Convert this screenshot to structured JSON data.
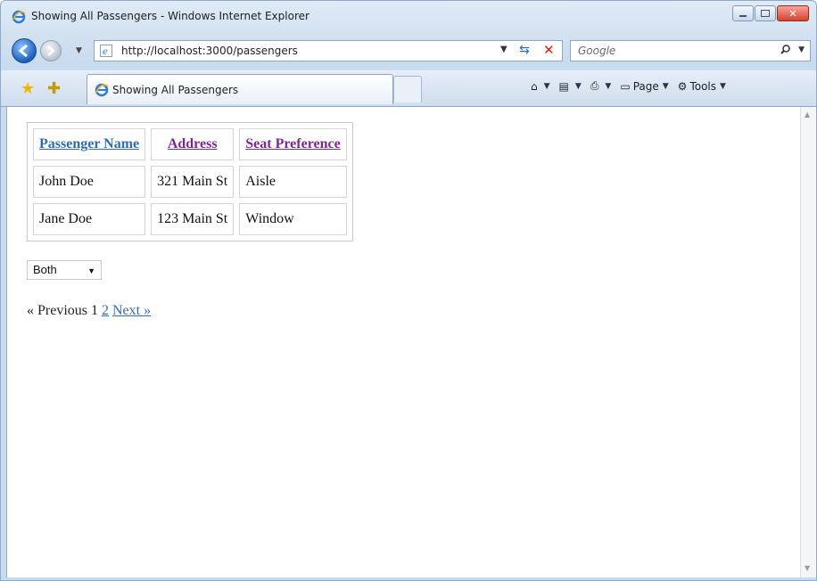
{
  "window": {
    "title": "Showing All Passengers - Windows Internet Explorer"
  },
  "navbar": {
    "url": "http://localhost:3000/passengers",
    "search_placeholder": "Google"
  },
  "tabbar": {
    "tab_title": "Showing All Passengers",
    "commands": [
      {
        "label": "",
        "icon": "home-icon"
      },
      {
        "label": "",
        "icon": "rss-feed-icon"
      },
      {
        "label": "",
        "icon": "print-icon"
      },
      {
        "label": "Page",
        "icon": "page-icon"
      },
      {
        "label": "Tools",
        "icon": "gear-icon"
      }
    ]
  },
  "table": {
    "headers": [
      "Passenger Name",
      "Address",
      "Seat Preference"
    ],
    "header_colors": [
      "#2f6cb0",
      "#7b2a8c",
      "#7b2a8c"
    ],
    "rows": [
      [
        "John Doe",
        "321 Main St",
        "Aisle"
      ],
      [
        "Jane Doe",
        "123 Main St",
        "Window"
      ]
    ]
  },
  "filter": {
    "selected": "Both"
  },
  "pagination": {
    "previous": "« Previous",
    "current": "1",
    "page2": "2",
    "next": "Next »"
  }
}
